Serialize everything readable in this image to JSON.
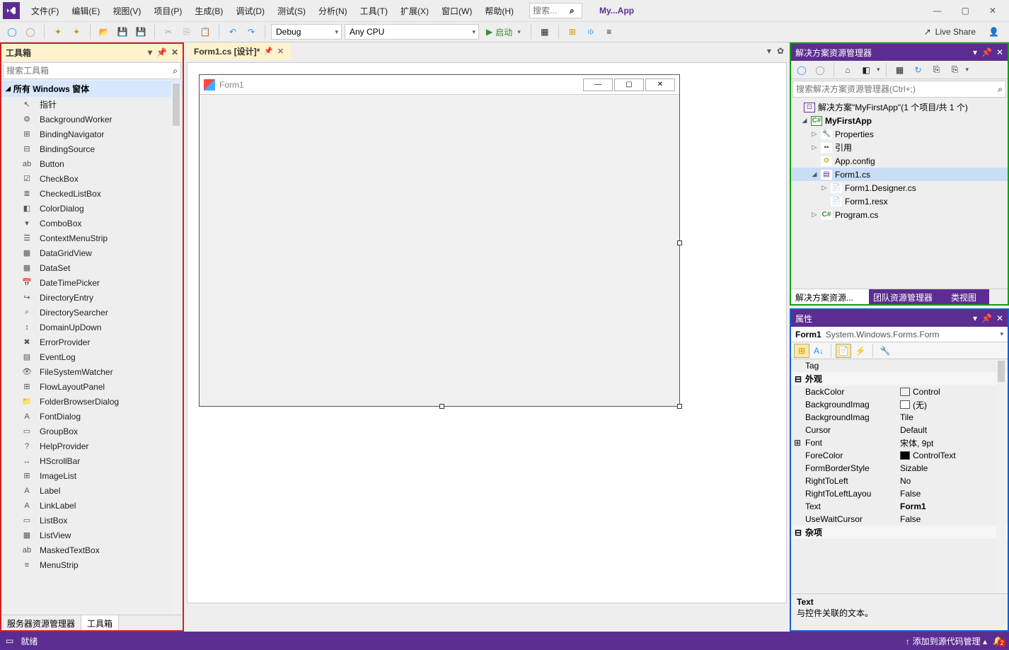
{
  "menubar": {
    "items": [
      "文件(F)",
      "编辑(E)",
      "视图(V)",
      "项目(P)",
      "生成(B)",
      "调试(D)",
      "测试(S)",
      "分析(N)",
      "工具(T)",
      "扩展(X)",
      "窗口(W)",
      "帮助(H)"
    ],
    "quick_launch_placeholder": "搜索...",
    "app_name": "My...App"
  },
  "toolbar": {
    "config": "Debug",
    "platform": "Any CPU",
    "start": "启动",
    "live_share": "Live Share"
  },
  "toolbox": {
    "title": "工具箱",
    "search_placeholder": "搜索工具箱",
    "group": "所有 Windows 窗体",
    "items": [
      "指针",
      "BackgroundWorker",
      "BindingNavigator",
      "BindingSource",
      "Button",
      "CheckBox",
      "CheckedListBox",
      "ColorDialog",
      "ComboBox",
      "ContextMenuStrip",
      "DataGridView",
      "DataSet",
      "DateTimePicker",
      "DirectoryEntry",
      "DirectorySearcher",
      "DomainUpDown",
      "ErrorProvider",
      "EventLog",
      "FileSystemWatcher",
      "FlowLayoutPanel",
      "FolderBrowserDialog",
      "FontDialog",
      "GroupBox",
      "HelpProvider",
      "HScrollBar",
      "ImageList",
      "Label",
      "LinkLabel",
      "ListBox",
      "ListView",
      "MaskedTextBox",
      "MenuStrip"
    ],
    "tabs": [
      "服务器资源管理器",
      "工具箱"
    ]
  },
  "designer": {
    "tab": "Form1.cs [设计]*",
    "form_title": "Form1"
  },
  "solution": {
    "title": "解决方案资源管理器",
    "search_placeholder": "搜索解决方案资源管理器(Ctrl+;)",
    "root": "解决方案\"MyFirstApp\"(1 个项目/共 1 个)",
    "project": "MyFirstApp",
    "nodes": {
      "properties": "Properties",
      "refs": "引用",
      "appconfig": "App.config",
      "form": "Form1.cs",
      "designer": "Form1.Designer.cs",
      "resx": "Form1.resx",
      "program": "Program.cs"
    },
    "tabs": [
      "解决方案资源...",
      "团队资源管理器",
      "类视图"
    ]
  },
  "props": {
    "title": "属性",
    "selector_name": "Form1",
    "selector_type": "System.Windows.Forms.Form",
    "rows": {
      "tag": {
        "n": "Tag",
        "v": ""
      },
      "sec_appearance": "外观",
      "backcolor": {
        "n": "BackColor",
        "v": "Control"
      },
      "bgimage": {
        "n": "BackgroundImag",
        "v": "(无)"
      },
      "bgimagelayout": {
        "n": "BackgroundImag",
        "v": "Tile"
      },
      "cursor": {
        "n": "Cursor",
        "v": "Default"
      },
      "font": {
        "n": "Font",
        "v": "宋体, 9pt"
      },
      "forecolor": {
        "n": "ForeColor",
        "v": "ControlText"
      },
      "formborder": {
        "n": "FormBorderStyle",
        "v": "Sizable"
      },
      "rtl": {
        "n": "RightToLeft",
        "v": "No"
      },
      "rtllayout": {
        "n": "RightToLeftLayou",
        "v": "False"
      },
      "text": {
        "n": "Text",
        "v": "Form1"
      },
      "usewait": {
        "n": "UseWaitCursor",
        "v": "False"
      },
      "sec_misc": "杂项"
    },
    "desc_title": "Text",
    "desc_body": "与控件关联的文本。"
  },
  "statusbar": {
    "ready": "就绪",
    "add_source": "添加到源代码管理",
    "notif": "2"
  }
}
